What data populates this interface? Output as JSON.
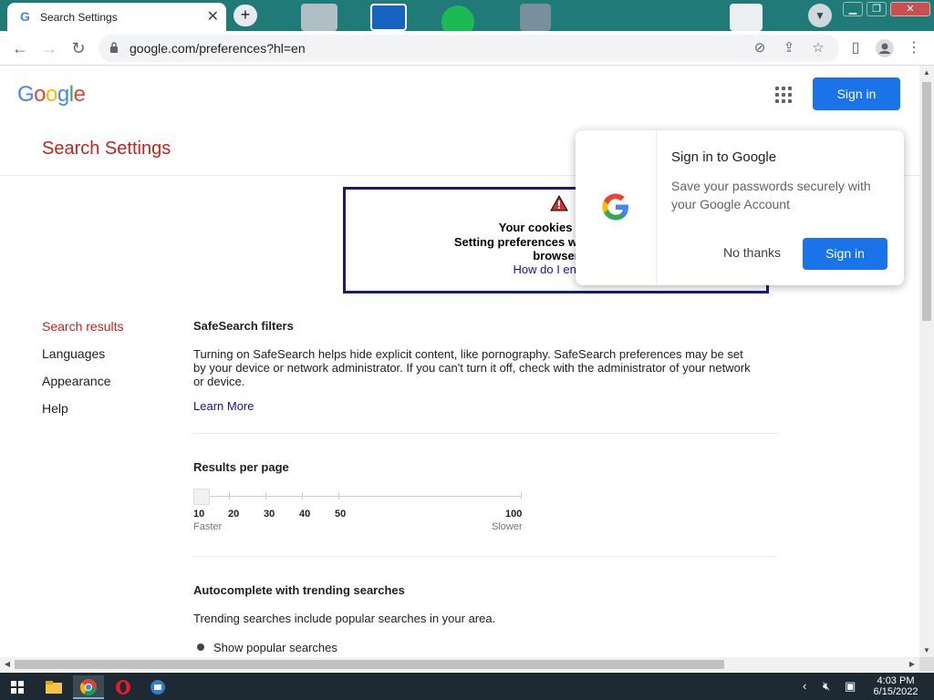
{
  "browser": {
    "tab": {
      "title": "Search Settings",
      "close": "✕"
    },
    "new_tab": "+",
    "url": "google.com/preferences?hl=en",
    "nav": {
      "back": "←",
      "forward": "→",
      "reload": "↻"
    },
    "menu": "⋮"
  },
  "header": {
    "logo_letters": [
      {
        "ch": "G",
        "color": "#4285F4"
      },
      {
        "ch": "o",
        "color": "#EA4335"
      },
      {
        "ch": "o",
        "color": "#FBBC05"
      },
      {
        "ch": "g",
        "color": "#4285F4"
      },
      {
        "ch": "l",
        "color": "#34A853"
      },
      {
        "ch": "e",
        "color": "#EA4335"
      }
    ],
    "sign_in": "Sign in"
  },
  "page_title": "Search Settings",
  "cookie_warning": {
    "line1": "Your cookies seem t",
    "line2": "Setting preferences will not work un",
    "line3": "browser",
    "link": "How do I enable"
  },
  "sidenav": [
    {
      "label": "Search results",
      "active": true
    },
    {
      "label": "Languages",
      "active": false
    },
    {
      "label": "Appearance",
      "active": false
    },
    {
      "label": "Help",
      "active": false
    }
  ],
  "safesearch": {
    "heading": "SafeSearch filters",
    "text": "Turning on SafeSearch helps hide explicit content, like pornography. SafeSearch preferences may be set by your device or network administrator. If you can't turn it off, check with the administrator of your network or device.",
    "learn_more": "Learn More"
  },
  "results_per_page": {
    "heading": "Results per page",
    "ticks": [
      "10",
      "20",
      "30",
      "40",
      "50",
      "100"
    ],
    "selected": "10",
    "faster": "Faster",
    "slower": "Slower"
  },
  "autocomplete": {
    "heading": "Autocomplete with trending searches",
    "text": "Trending searches include popular searches in your area.",
    "option": "Show popular searches"
  },
  "signin_popup": {
    "title": "Sign in to Google",
    "description": "Save your passwords securely with your Google Account",
    "no_thanks": "No thanks",
    "sign_in": "Sign in"
  },
  "taskbar": {
    "time": "4:03 PM",
    "date": "6/15/2022"
  },
  "colors": {
    "accent_blue": "#1a73e8",
    "title_red": "#c5221f",
    "link_blue": "#1a0dab"
  }
}
